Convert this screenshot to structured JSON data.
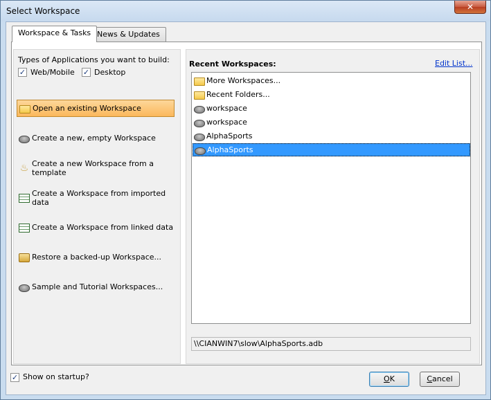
{
  "window": {
    "title": "Select Workspace",
    "close_glyph": "✕"
  },
  "tabs": [
    {
      "label": "Workspace & Tasks",
      "active": true
    },
    {
      "label": "News & Updates",
      "active": false
    }
  ],
  "left": {
    "types_label": "Types of Applications you want to build:",
    "checks": [
      {
        "label": "Web/Mobile",
        "checked": true
      },
      {
        "label": "Desktop",
        "checked": true
      }
    ],
    "actions": [
      {
        "label": "Open an existing Workspace",
        "icon": "folder-icon",
        "selected": true
      },
      {
        "label": "Create a new, empty Workspace",
        "icon": "new-db-icon",
        "selected": false
      },
      {
        "label": "Create a new Workspace from a template",
        "icon": "lamp-icon",
        "selected": false
      },
      {
        "label": "Create a Workspace from imported data",
        "icon": "import-table-icon",
        "selected": false
      },
      {
        "label": "Create a Workspace from linked data",
        "icon": "linked-table-icon",
        "selected": false
      },
      {
        "label": "Restore a backed-up Workspace...",
        "icon": "restore-icon",
        "selected": false
      },
      {
        "label": "Sample and Tutorial Workspaces...",
        "icon": "sample-db-icon",
        "selected": false
      }
    ]
  },
  "right": {
    "recent_label": "Recent Workspaces:",
    "edit_link": "Edit List...",
    "items": [
      {
        "label": "More Workspaces...",
        "icon": "open-folder-icon",
        "selected": false
      },
      {
        "label": "Recent Folders...",
        "icon": "folder-icon",
        "selected": false
      },
      {
        "label": "workspace",
        "icon": "database-icon",
        "selected": false
      },
      {
        "label": "workspace",
        "icon": "database-icon",
        "selected": false
      },
      {
        "label": "AlphaSports",
        "icon": "database-icon",
        "selected": false
      },
      {
        "label": "AlphaSports",
        "icon": "database-icon",
        "selected": true
      }
    ],
    "path": "\\\\CIANWIN7\\slow\\AlphaSports.adb"
  },
  "footer": {
    "show_on_startup": "Show on startup?",
    "show_on_startup_checked": true,
    "ok_label": "OK",
    "cancel_label": "Cancel"
  },
  "check_glyph": "✓"
}
